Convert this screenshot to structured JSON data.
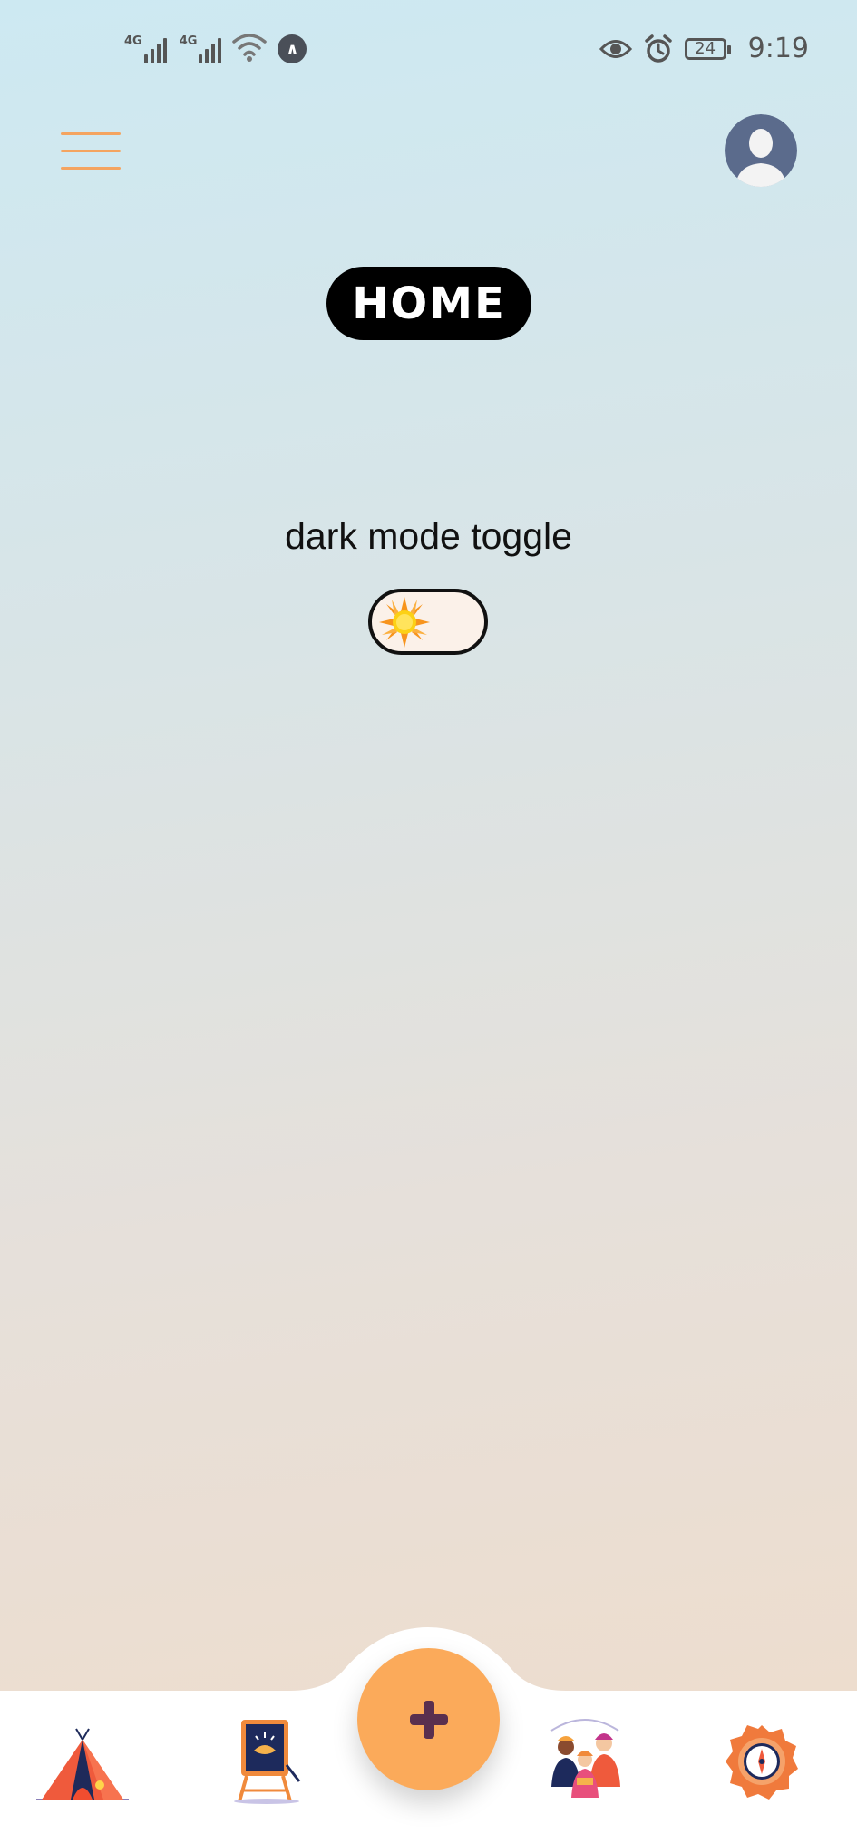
{
  "status_bar": {
    "network_1": "4G",
    "network_2": "4G",
    "battery": "24",
    "time": "9:19",
    "icons": [
      "signal-icon",
      "signal-icon",
      "wifi-icon",
      "vpn-icon",
      "eye-icon",
      "alarm-icon",
      "battery-icon"
    ]
  },
  "header": {
    "menu_icon": "hamburger-menu-icon",
    "avatar_icon": "user-avatar-icon",
    "title": "HOME"
  },
  "main": {
    "toggle_label": "dark mode toggle",
    "toggle_icon": "sun-icon",
    "dark_mode_on": false
  },
  "bottom_nav": {
    "items": [
      {
        "icon": "tent-icon"
      },
      {
        "icon": "easel-board-icon"
      },
      {
        "icon": "add-icon"
      },
      {
        "icon": "people-group-icon"
      },
      {
        "icon": "compass-gear-icon"
      }
    ]
  },
  "colors": {
    "accent": "#fbaa5a",
    "menu_lines": "#f4a460",
    "title_bg": "#000000",
    "avatar_bg": "#5b6b8c"
  }
}
